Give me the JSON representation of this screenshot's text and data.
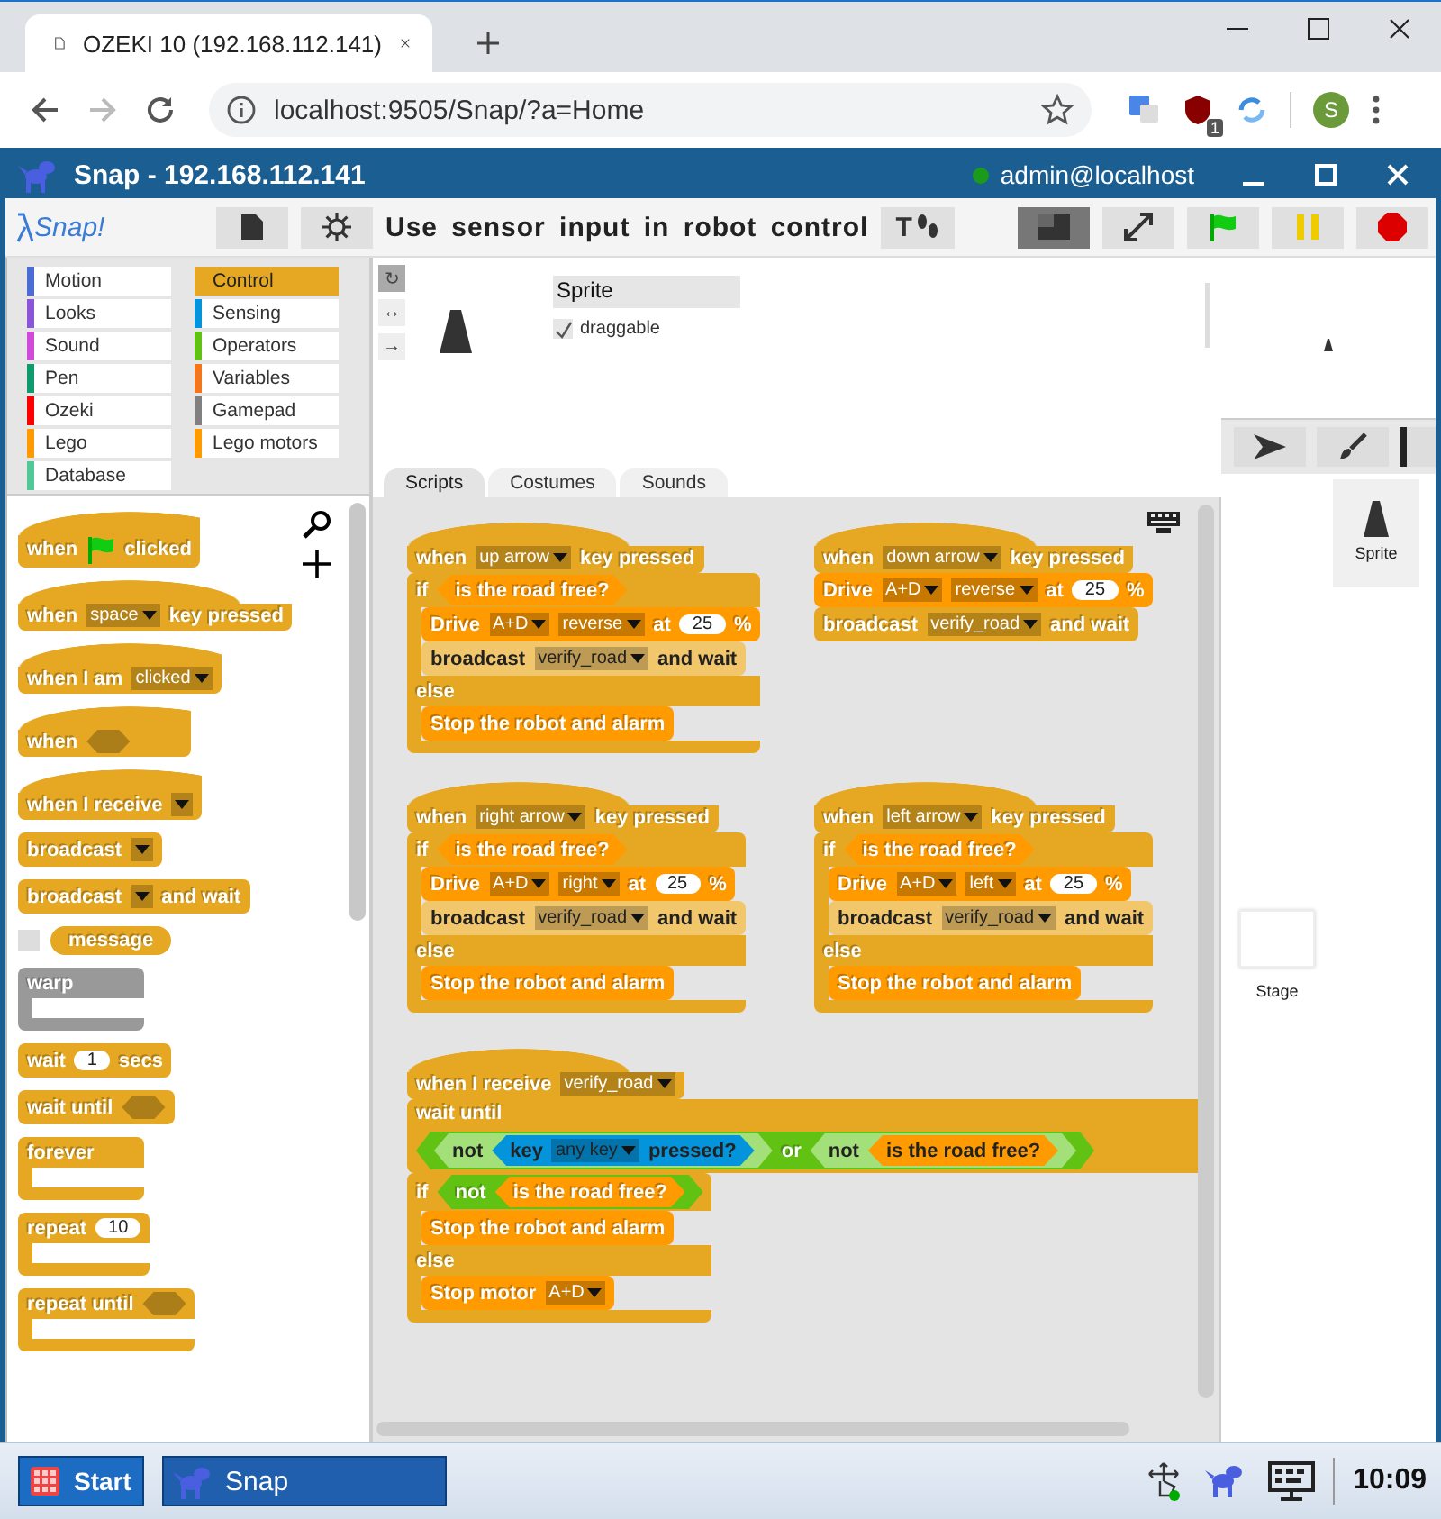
{
  "browser": {
    "tab_title": "OZEKI 10 (192.168.112.141)",
    "address": "localhost:9505/Snap/?a=Home",
    "ublock_badge": "1",
    "profile": "S"
  },
  "window": {
    "title": "Snap - 192.168.112.141",
    "online": true,
    "user": "admin@localhost"
  },
  "toolbar": {
    "logo": "Snap!",
    "project": "Use sensor input in robot control",
    "step_label": "T",
    "small_stage": true
  },
  "categories": [
    {
      "label": "Motion",
      "color": "#4a6cd4",
      "selected": false
    },
    {
      "label": "Control",
      "color": "#e6a822",
      "selected": true
    },
    {
      "label": "Looks",
      "color": "#8a55d7",
      "selected": false
    },
    {
      "label": "Sensing",
      "color": "#0494dc",
      "selected": false
    },
    {
      "label": "Sound",
      "color": "#cf4ad9",
      "selected": false
    },
    {
      "label": "Operators",
      "color": "#62c213",
      "selected": false
    },
    {
      "label": "Pen",
      "color": "#0e9a6c",
      "selected": false
    },
    {
      "label": "Variables",
      "color": "#f3761d",
      "selected": false
    },
    {
      "label": "Ozeki",
      "color": "#ff0000",
      "selected": false
    },
    {
      "label": "Gamepad",
      "color": "#808080",
      "selected": false
    },
    {
      "label": "Lego",
      "color": "#ff9a00",
      "selected": false
    },
    {
      "label": "Lego motors",
      "color": "#ff9a00",
      "selected": false
    },
    {
      "label": "Database",
      "color": "#52c89a",
      "selected": false
    }
  ],
  "palette": [
    {
      "kind": "hat",
      "color": "#e6a822",
      "parts": [
        "when",
        {
          "kind": "flag"
        },
        "clicked"
      ]
    },
    {
      "kind": "hat",
      "color": "#e6a822",
      "parts": [
        "when",
        {
          "kind": "menu",
          "text": "space"
        },
        "key pressed"
      ]
    },
    {
      "kind": "hat",
      "color": "#e6a822",
      "parts": [
        "when I am",
        {
          "kind": "menu",
          "text": "clicked"
        }
      ]
    },
    {
      "kind": "hat",
      "color": "#e6a822",
      "parts": [
        "when",
        {
          "kind": "slot"
        }
      ]
    },
    {
      "kind": "hat",
      "color": "#e6a822",
      "parts": [
        "when I receive",
        {
          "kind": "menu"
        }
      ]
    },
    {
      "kind": "command",
      "color": "#e6a822",
      "parts": [
        "broadcast",
        {
          "kind": "menu"
        }
      ]
    },
    {
      "kind": "command",
      "color": "#e6a822",
      "parts": [
        "broadcast",
        {
          "kind": "menu"
        },
        "and wait"
      ]
    },
    {
      "kind": "reporter",
      "color": "#e6a822",
      "checkbox": false,
      "parts": [
        "message"
      ]
    },
    {
      "kind": "c",
      "color": "#999999",
      "arms": [
        {
          "parts": [
            "warp"
          ]
        }
      ]
    },
    {
      "kind": "command",
      "color": "#e6a822",
      "parts": [
        "wait",
        {
          "kind": "num",
          "text": "1"
        },
        "secs"
      ]
    },
    {
      "kind": "command",
      "color": "#e6a822",
      "parts": [
        "wait until",
        {
          "kind": "slot"
        }
      ]
    },
    {
      "kind": "c",
      "color": "#e6a822",
      "arms": [
        {
          "parts": [
            "forever"
          ]
        }
      ]
    },
    {
      "kind": "c",
      "color": "#e6a822",
      "arms": [
        {
          "parts": [
            "repeat",
            {
              "kind": "num",
              "text": "10"
            }
          ]
        }
      ]
    },
    {
      "kind": "c",
      "color": "#e6a822",
      "arms": [
        {
          "parts": [
            "repeat until",
            {
              "kind": "slot"
            }
          ]
        }
      ]
    }
  ],
  "sprite": {
    "name": "Sprite",
    "draggable": true,
    "draggable_label": "draggable",
    "rotation": [
      {
        "label": "↻",
        "selected": true
      },
      {
        "label": "↔",
        "selected": false
      },
      {
        "label": "→",
        "selected": false
      }
    ]
  },
  "tabs": [
    {
      "label": "Scripts",
      "selected": true
    },
    {
      "label": "Costumes",
      "selected": false
    },
    {
      "label": "Sounds",
      "selected": false
    }
  ],
  "scripts": [
    [
      {
        "kind": "hat",
        "color": "#e6a822",
        "parts": [
          "when",
          {
            "kind": "menu",
            "text": "up arrow"
          },
          "key pressed"
        ]
      },
      {
        "kind": "c",
        "color": "#e6a822",
        "arms": [
          {
            "parts": [
              "if",
              {
                "kind": "bool",
                "color": "#ff9a00",
                "parts": [
                  "is the road free?"
                ]
              }
            ],
            "blocks": [
              {
                "kind": "command",
                "color": "#ff9a00",
                "parts": [
                  "Drive",
                  {
                    "kind": "menu",
                    "text": "A+D"
                  },
                  {
                    "kind": "menu",
                    "text": "reverse"
                  },
                  "at",
                  {
                    "kind": "num",
                    "text": "25"
                  },
                  "%"
                ]
              },
              {
                "kind": "command",
                "color": "#f2c76c",
                "parts": [
                  "broadcast",
                  {
                    "kind": "menu",
                    "text": "verify_road"
                  },
                  "and wait"
                ]
              }
            ]
          },
          {
            "parts": [
              "else"
            ],
            "blocks": [
              {
                "kind": "command",
                "color": "#ff9a00",
                "parts": [
                  "Stop the robot and alarm"
                ]
              }
            ]
          }
        ]
      }
    ],
    [
      {
        "kind": "hat",
        "color": "#e6a822",
        "parts": [
          "when",
          {
            "kind": "menu",
            "text": "down arrow"
          },
          "key pressed"
        ]
      },
      {
        "kind": "command",
        "color": "#ff9a00",
        "parts": [
          "Drive",
          {
            "kind": "menu",
            "text": "A+D"
          },
          {
            "kind": "menu",
            "text": "reverse"
          },
          "at",
          {
            "kind": "num",
            "text": "25"
          },
          "%"
        ]
      },
      {
        "kind": "command",
        "color": "#e6a822",
        "parts": [
          "broadcast",
          {
            "kind": "menu",
            "text": "verify_road"
          },
          "and wait"
        ]
      }
    ],
    [
      {
        "kind": "hat",
        "color": "#e6a822",
        "parts": [
          "when",
          {
            "kind": "menu",
            "text": "right arrow"
          },
          "key pressed"
        ]
      },
      {
        "kind": "c",
        "color": "#e6a822",
        "arms": [
          {
            "parts": [
              "if",
              {
                "kind": "bool",
                "color": "#ff9a00",
                "parts": [
                  "is the road free?"
                ]
              }
            ],
            "blocks": [
              {
                "kind": "command",
                "color": "#ff9a00",
                "parts": [
                  "Drive",
                  {
                    "kind": "menu",
                    "text": "A+D"
                  },
                  {
                    "kind": "menu",
                    "text": "right"
                  },
                  "at",
                  {
                    "kind": "num",
                    "text": "25"
                  },
                  "%"
                ]
              },
              {
                "kind": "command",
                "color": "#f2c76c",
                "parts": [
                  "broadcast",
                  {
                    "kind": "menu",
                    "text": "verify_road"
                  },
                  "and wait"
                ]
              }
            ]
          },
          {
            "parts": [
              "else"
            ],
            "blocks": [
              {
                "kind": "command",
                "color": "#ff9a00",
                "parts": [
                  "Stop the robot and alarm"
                ]
              }
            ]
          }
        ]
      }
    ],
    [
      {
        "kind": "hat",
        "color": "#e6a822",
        "parts": [
          "when",
          {
            "kind": "menu",
            "text": "left arrow"
          },
          "key pressed"
        ]
      },
      {
        "kind": "c",
        "color": "#e6a822",
        "arms": [
          {
            "parts": [
              "if",
              {
                "kind": "bool",
                "color": "#ff9a00",
                "parts": [
                  "is the road free?"
                ]
              }
            ],
            "blocks": [
              {
                "kind": "command",
                "color": "#ff9a00",
                "parts": [
                  "Drive",
                  {
                    "kind": "menu",
                    "text": "A+D"
                  },
                  {
                    "kind": "menu",
                    "text": "left"
                  },
                  "at",
                  {
                    "kind": "num",
                    "text": "25"
                  },
                  "%"
                ]
              },
              {
                "kind": "command",
                "color": "#f2c76c",
                "parts": [
                  "broadcast",
                  {
                    "kind": "menu",
                    "text": "verify_road"
                  },
                  "and wait"
                ]
              }
            ]
          },
          {
            "parts": [
              "else"
            ],
            "blocks": [
              {
                "kind": "command",
                "color": "#ff9a00",
                "parts": [
                  "Stop the robot and alarm"
                ]
              }
            ]
          }
        ]
      }
    ],
    [
      {
        "kind": "hat",
        "color": "#e6a822",
        "parts": [
          "when I receive",
          {
            "kind": "menu",
            "text": "verify_road"
          }
        ]
      },
      {
        "kind": "command",
        "color": "#e6a822",
        "parts": [
          "wait until",
          {
            "kind": "break"
          },
          {
            "kind": "bool",
            "color": "#62c213",
            "parts": [
              {
                "kind": "bool",
                "color": "#a3e07a",
                "parts": [
                  "not",
                  {
                    "kind": "bool",
                    "color": "#0494dc",
                    "parts": [
                      "key",
                      {
                        "kind": "menu",
                        "text": "any key"
                      },
                      "pressed?"
                    ]
                  }
                ]
              },
              "or",
              {
                "kind": "bool",
                "color": "#a3e07a",
                "parts": [
                  "not",
                  {
                    "kind": "bool",
                    "color": "#ff9a00",
                    "parts": [
                      "is the road free?"
                    ]
                  }
                ]
              }
            ]
          }
        ]
      },
      {
        "kind": "c",
        "color": "#e6a822",
        "arms": [
          {
            "parts": [
              "if",
              {
                "kind": "bool",
                "color": "#62c213",
                "parts": [
                  "not",
                  {
                    "kind": "bool",
                    "color": "#ff9a00",
                    "parts": [
                      "is the road free?"
                    ]
                  }
                ]
              }
            ],
            "blocks": [
              {
                "kind": "command",
                "color": "#ff9a00",
                "parts": [
                  "Stop the robot and alarm"
                ]
              }
            ]
          },
          {
            "parts": [
              "else"
            ],
            "blocks": [
              {
                "kind": "command",
                "color": "#ff9a00",
                "parts": [
                  "Stop motor",
                  {
                    "kind": "menu",
                    "text": "A+D"
                  }
                ]
              }
            ]
          }
        ]
      }
    ]
  ],
  "corral": {
    "sprites": [
      {
        "name": "Sprite",
        "selected": true
      }
    ],
    "stage_label": "Stage"
  },
  "taskbar": {
    "start": "Start",
    "task": "Snap",
    "time": "10:09"
  }
}
